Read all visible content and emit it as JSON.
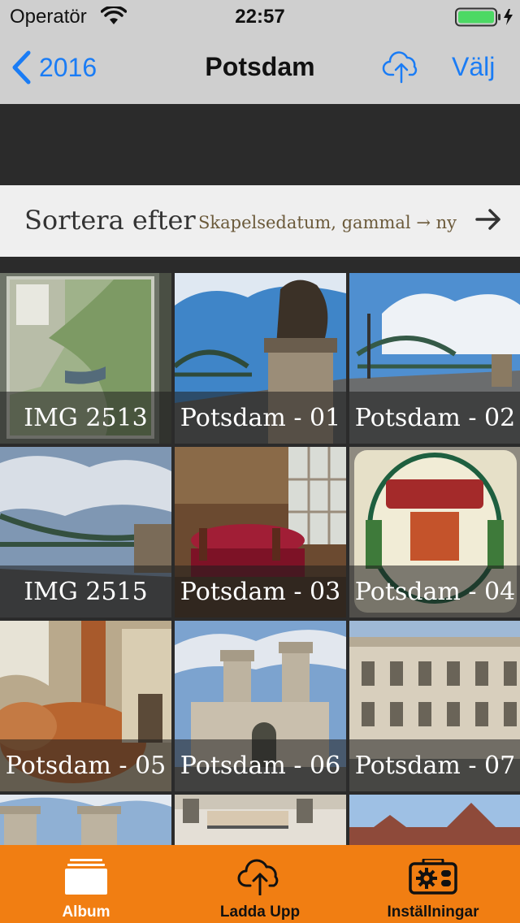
{
  "status": {
    "carrier": "Operatör",
    "time": "22:57"
  },
  "nav": {
    "back_label": "2016",
    "title": "Potsdam",
    "select_label": "Välj"
  },
  "sort": {
    "label": "Sortera efter",
    "value": "Skapelsedatum, gammal → ny"
  },
  "photos": [
    {
      "caption": "IMG 2513"
    },
    {
      "caption": "Potsdam - 01"
    },
    {
      "caption": "Potsdam - 02"
    },
    {
      "caption": "IMG 2515"
    },
    {
      "caption": "Potsdam - 03"
    },
    {
      "caption": "Potsdam - 04"
    },
    {
      "caption": "Potsdam - 05"
    },
    {
      "caption": "Potsdam - 06"
    },
    {
      "caption": "Potsdam - 07"
    },
    {
      "caption": ""
    },
    {
      "caption": ""
    },
    {
      "caption": ""
    }
  ],
  "tabs": [
    {
      "label": "Album",
      "icon": "album-icon",
      "selected": true
    },
    {
      "label": "Ladda Upp",
      "icon": "cloud-upload-icon",
      "selected": false
    },
    {
      "label": "Inställningar",
      "icon": "settings-camera-icon",
      "selected": false
    }
  ],
  "colors": {
    "accent": "#1a7cf5",
    "tab_bar": "#f17e12",
    "battery": "#4cd964"
  }
}
